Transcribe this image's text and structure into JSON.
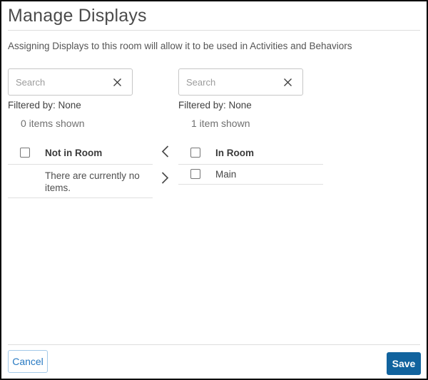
{
  "dialog": {
    "title": "Manage Displays",
    "description": "Assigning Displays to this room will allow it to be used in Activities and Behaviors"
  },
  "panels": {
    "left": {
      "search_placeholder": "Search",
      "search_value": "",
      "filtered_by": "Filtered by: None",
      "items_shown": "0 items shown",
      "header": "Not in Room",
      "empty_message": "There are currently no items.",
      "items": []
    },
    "right": {
      "search_placeholder": "Search",
      "search_value": "",
      "filtered_by": "Filtered by: None",
      "items_shown": "1 item shown",
      "header": "In Room",
      "items": [
        "Main"
      ]
    }
  },
  "icons": {
    "clear_search": "clear-x",
    "move_left": "chevron-left",
    "move_right": "chevron-right"
  },
  "checkboxes": {
    "left_header_checked": false,
    "right_header_checked": false,
    "right_item_checked": false
  },
  "footer": {
    "cancel_label": "Cancel",
    "save_label": "Save"
  },
  "colors": {
    "primary_button": "#11639e",
    "secondary_border": "#a3c9e8",
    "secondary_text": "#2779c2",
    "divider": "#e0e0e0",
    "checkbox_border": "#767676"
  }
}
